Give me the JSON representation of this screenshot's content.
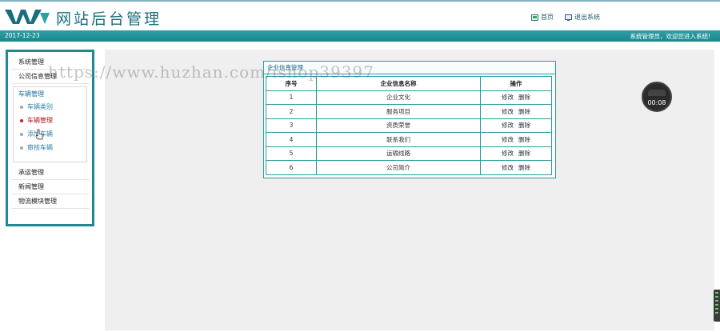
{
  "header": {
    "title": "网站后台管理",
    "nav": [
      {
        "label": "首页",
        "icon": "home-icon"
      },
      {
        "label": "退出系统",
        "icon": "logout-icon"
      }
    ]
  },
  "topbar": {
    "date": "2017-12-23",
    "welcome": "系统管理员，欢迎您进入系统!"
  },
  "sidebar": {
    "items_top": [
      "系统管理",
      "公司信息管理"
    ],
    "group": {
      "title": "车辆管理",
      "items": [
        {
          "label": "车辆类别",
          "active": false
        },
        {
          "label": "车辆管理",
          "active": true
        },
        {
          "label": "添加车辆",
          "active": false
        },
        {
          "label": "审核车辆",
          "active": false
        }
      ]
    },
    "items_bottom": [
      "承运管理",
      "新闻管理",
      "物流模块管理"
    ]
  },
  "panel": {
    "title": "企业信息管理",
    "columns": [
      "序号",
      "企业信息名称",
      "操作"
    ],
    "rows": [
      {
        "no": "1",
        "name": "企业文化",
        "edit": "修改",
        "del": "删除"
      },
      {
        "no": "2",
        "name": "服务项目",
        "edit": "修改",
        "del": "删除"
      },
      {
        "no": "3",
        "name": "资质荣誉",
        "edit": "修改",
        "del": "删除"
      },
      {
        "no": "4",
        "name": "联系我们",
        "edit": "修改",
        "del": "删除"
      },
      {
        "no": "5",
        "name": "运输线路",
        "edit": "修改",
        "del": "删除"
      },
      {
        "no": "6",
        "name": "公司简介",
        "edit": "修改",
        "del": "删除"
      }
    ]
  },
  "watermark": "https://www.huzhan.com/ishop39397",
  "timer": "00:08",
  "colors": {
    "accent": "#1e8a90",
    "title": "#1a6e7c",
    "active": "#c81e1e"
  }
}
